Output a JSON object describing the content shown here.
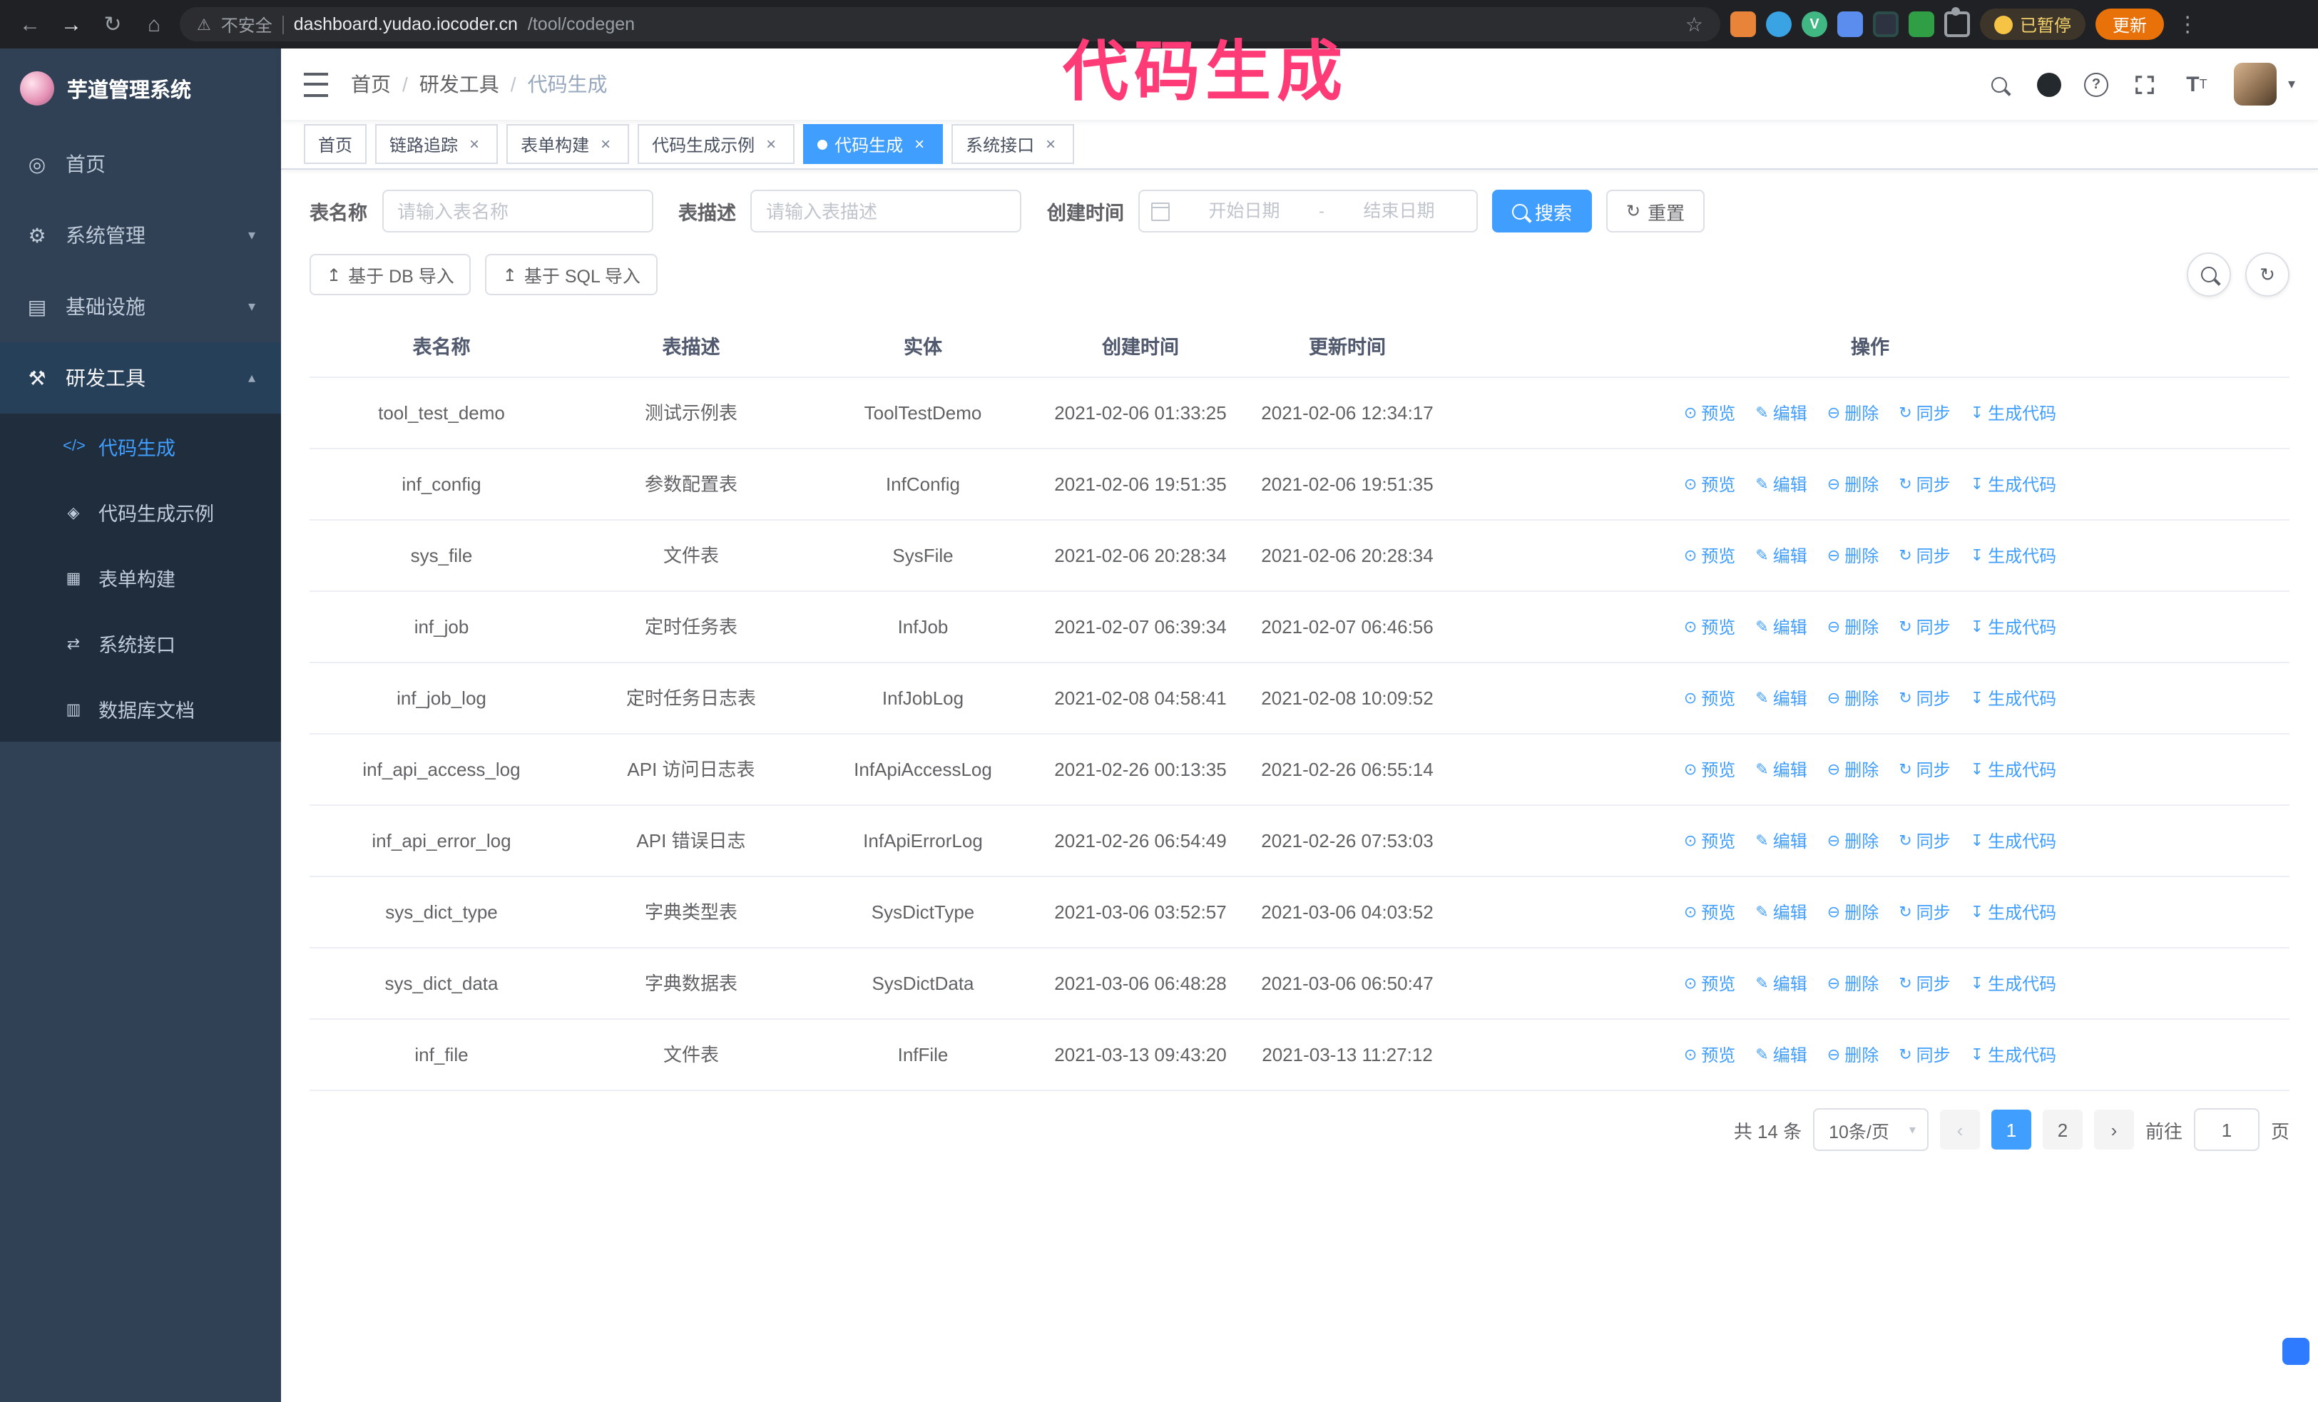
{
  "annotation": {
    "text": "代码生成",
    "color": "#ff3b77"
  },
  "accent_color": "#409eff",
  "browser": {
    "security_label": "不安全",
    "url_host": "dashboard.yudao.iocoder.cn",
    "url_path": "/tool/codegen",
    "paused_badge": "已暂停",
    "update_button": "更新"
  },
  "sidebar": {
    "logo_title": "芋道管理系统",
    "items": [
      {
        "label": "首页",
        "icon": "dashboard-icon"
      },
      {
        "label": "系统管理",
        "icon": "gear-icon"
      },
      {
        "label": "基础设施",
        "icon": "infra-icon"
      },
      {
        "label": "研发工具",
        "icon": "tools-icon",
        "expanded": true
      }
    ],
    "subitems": [
      {
        "label": "代码生成",
        "icon": "code-icon",
        "active": true
      },
      {
        "label": "代码生成示例",
        "icon": "example-icon"
      },
      {
        "label": "表单构建",
        "icon": "form-icon"
      },
      {
        "label": "系统接口",
        "icon": "api-icon"
      },
      {
        "label": "数据库文档",
        "icon": "db-icon"
      }
    ]
  },
  "header": {
    "breadcrumb": [
      "首页",
      "研发工具",
      "代码生成"
    ],
    "breadcrumb_separator": "/"
  },
  "tabs": [
    {
      "label": "首页",
      "closable": false,
      "active": false
    },
    {
      "label": "链路追踪",
      "closable": true,
      "active": false
    },
    {
      "label": "表单构建",
      "closable": true,
      "active": false
    },
    {
      "label": "代码生成示例",
      "closable": true,
      "active": false
    },
    {
      "label": "代码生成",
      "closable": true,
      "active": true
    },
    {
      "label": "系统接口",
      "closable": true,
      "active": false
    }
  ],
  "filters": {
    "name_label": "表名称",
    "name_placeholder": "请输入表名称",
    "desc_label": "表描述",
    "desc_placeholder": "请输入表描述",
    "time_label": "创建时间",
    "start_placeholder": "开始日期",
    "range_separator": "-",
    "end_placeholder": "结束日期",
    "search_button": "搜索",
    "reset_button": "重置"
  },
  "toolbar": {
    "import_db": "基于 DB 导入",
    "import_sql": "基于 SQL 导入"
  },
  "table": {
    "columns": [
      "表名称",
      "表描述",
      "实体",
      "创建时间",
      "更新时间",
      "操作"
    ],
    "rows": [
      {
        "name": "tool_test_demo",
        "desc": "测试示例表",
        "entity": "ToolTestDemo",
        "created": "2021-02-06 01:33:25",
        "updated": "2021-02-06 12:34:17"
      },
      {
        "name": "inf_config",
        "desc": "参数配置表",
        "entity": "InfConfig",
        "created": "2021-02-06 19:51:35",
        "updated": "2021-02-06 19:51:35"
      },
      {
        "name": "sys_file",
        "desc": "文件表",
        "entity": "SysFile",
        "created": "2021-02-06 20:28:34",
        "updated": "2021-02-06 20:28:34"
      },
      {
        "name": "inf_job",
        "desc": "定时任务表",
        "entity": "InfJob",
        "created": "2021-02-07 06:39:34",
        "updated": "2021-02-07 06:46:56"
      },
      {
        "name": "inf_job_log",
        "desc": "定时任务日志表",
        "entity": "InfJobLog",
        "created": "2021-02-08 04:58:41",
        "updated": "2021-02-08 10:09:52"
      },
      {
        "name": "inf_api_access_log",
        "desc": "API 访问日志表",
        "entity": "InfApiAccessLog",
        "created": "2021-02-26 00:13:35",
        "updated": "2021-02-26 06:55:14"
      },
      {
        "name": "inf_api_error_log",
        "desc": "API 错误日志",
        "entity": "InfApiErrorLog",
        "created": "2021-02-26 06:54:49",
        "updated": "2021-02-26 07:53:03"
      },
      {
        "name": "sys_dict_type",
        "desc": "字典类型表",
        "entity": "SysDictType",
        "created": "2021-03-06 03:52:57",
        "updated": "2021-03-06 04:03:52"
      },
      {
        "name": "sys_dict_data",
        "desc": "字典数据表",
        "entity": "SysDictData",
        "created": "2021-03-06 06:48:28",
        "updated": "2021-03-06 06:50:47"
      },
      {
        "name": "inf_file",
        "desc": "文件表",
        "entity": "InfFile",
        "created": "2021-03-13 09:43:20",
        "updated": "2021-03-13 11:27:12"
      }
    ],
    "row_actions": [
      {
        "label": "预览",
        "icon": "eye-icon",
        "name": "preview-action"
      },
      {
        "label": "编辑",
        "icon": "edit-icon",
        "name": "edit-action"
      },
      {
        "label": "删除",
        "icon": "delete-icon",
        "name": "delete-action"
      },
      {
        "label": "同步",
        "icon": "sync-icon",
        "name": "sync-action"
      },
      {
        "label": "生成代码",
        "icon": "download-icon",
        "name": "generate-code-action"
      }
    ]
  },
  "pagination": {
    "total_text": "共 14 条",
    "page_size": "10条/页",
    "pages": [
      "1",
      "2"
    ],
    "active_page": "1",
    "goto_label": "前往",
    "goto_value": "1",
    "goto_suffix": "页"
  }
}
